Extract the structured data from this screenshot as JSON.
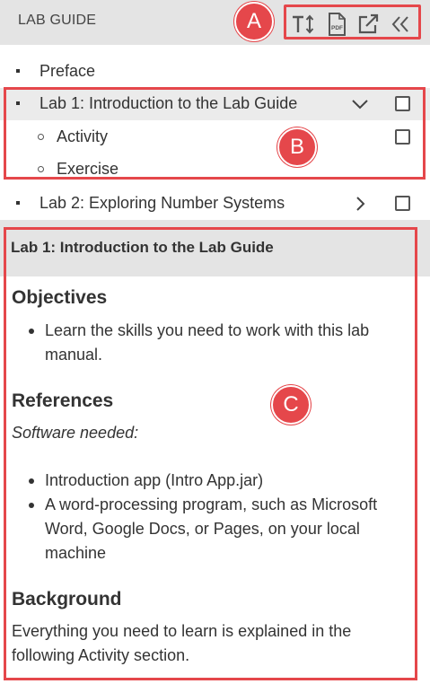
{
  "header": {
    "title": "LAB GUIDE",
    "tools": [
      {
        "name": "text-size-icon"
      },
      {
        "name": "pdf-icon",
        "text": "PDF"
      },
      {
        "name": "external-link-icon"
      },
      {
        "name": "collapse-icon"
      }
    ]
  },
  "callouts": {
    "a": "A",
    "b": "B",
    "c": "C"
  },
  "toc": {
    "preface": "Preface",
    "lab1": "Lab 1: Introduction to the Lab Guide",
    "activity": "Activity",
    "exercise": "Exercise",
    "lab2": "Lab 2: Exploring Number Systems"
  },
  "content": {
    "heading": "Lab 1: Introduction to the Lab Guide",
    "objectives_title": "Objectives",
    "objectives": [
      "Learn the skills you need to work with this lab manual."
    ],
    "references_title": "References",
    "software_needed": "Software needed:",
    "references": [
      "Introduction app (Intro App.jar)",
      "A word-processing program, such as Microsoft Word, Google Docs, or Pages, on your local machine"
    ],
    "background_title": "Background",
    "background_text": "Everything you need to learn is explained in the following Activity section."
  },
  "colors": {
    "accent": "#e5474b",
    "header_bg": "#e4e4e4"
  }
}
